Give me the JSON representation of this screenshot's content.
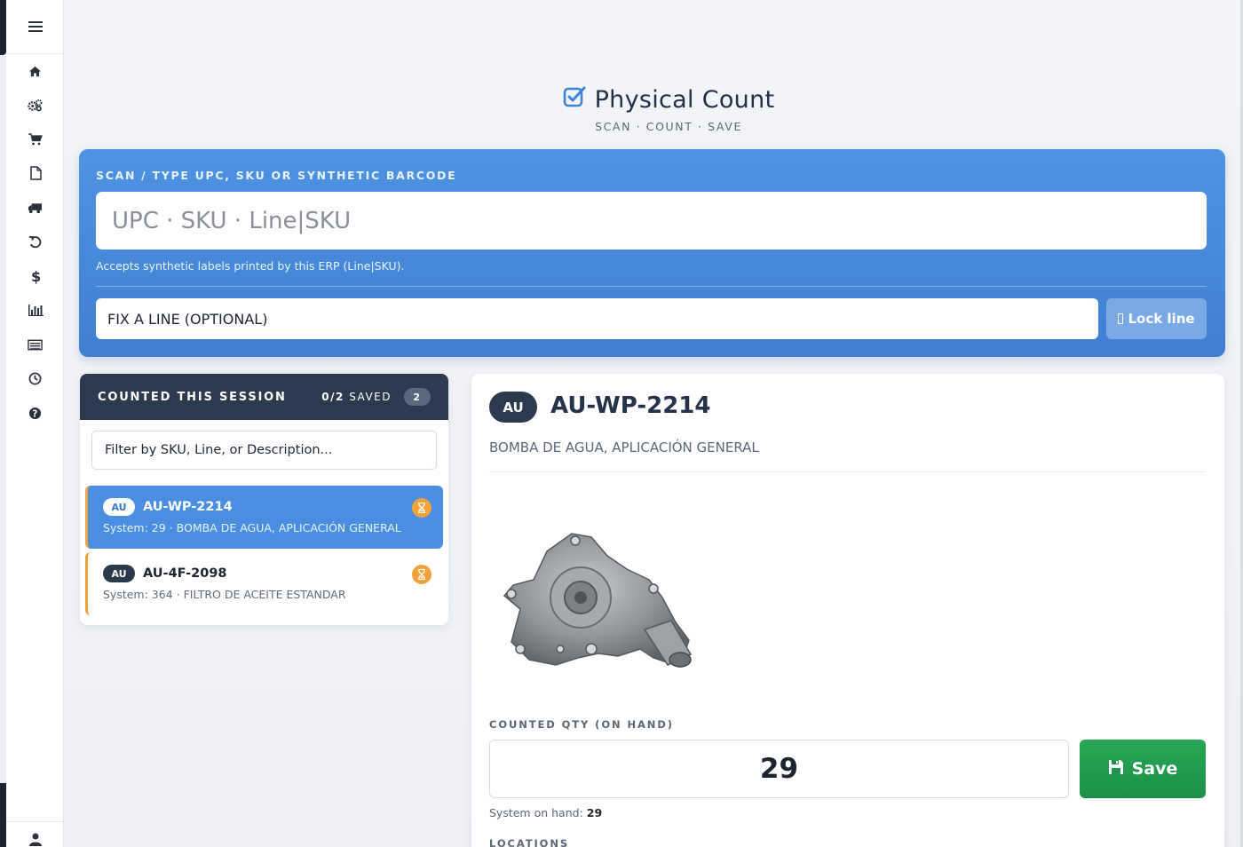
{
  "sidebar": {
    "icons": [
      "menu-icon",
      "home-icon",
      "gears-icon",
      "cart-icon",
      "file-icon",
      "truck-icon",
      "undo-icon",
      "dollar-icon",
      "bar-chart-icon",
      "list-icon",
      "clock-icon",
      "question-icon",
      "user-icon"
    ]
  },
  "header": {
    "title": "Physical Count",
    "subtitle": "SCAN · COUNT · SAVE"
  },
  "scan": {
    "label": "SCAN / TYPE UPC, SKU OR SYNTHETIC BARCODE",
    "placeholder": "UPC · SKU · Line|SKU",
    "hint": "Accepts synthetic labels printed by this ERP (Line|SKU).",
    "fix_placeholder": "FIX A LINE (OPTIONAL)",
    "lock_label": "Lock line"
  },
  "session": {
    "title": "COUNTED THIS SESSION",
    "saved_count": "0/2",
    "saved_label": "SAVED",
    "total": "2",
    "filter_placeholder": "Filter by SKU, Line, or Description...",
    "items": [
      {
        "line": "AU",
        "sku": "AU-WP-2214",
        "info": "System: 29 · BOMBA DE AGUA, APLICACIÓN GENERAL"
      },
      {
        "line": "AU",
        "sku": "AU-4F-2098",
        "info": "System: 364 · FILTRO DE ACEITE ESTANDAR"
      }
    ]
  },
  "detail": {
    "line": "AU",
    "sku": "AU-WP-2214",
    "description": "BOMBA DE AGUA, APLICACIÓN GENERAL",
    "qty_label": "COUNTED QTY (ON HAND)",
    "qty_value": "29",
    "save_label": "Save",
    "system_label": "System on hand:",
    "system_value": "29",
    "locations_label": "LOCATIONS"
  },
  "colors": {
    "accent": "#4a8ee2",
    "dark": "#2c3a4f",
    "save": "#22a150",
    "pending": "#f0a33a"
  }
}
